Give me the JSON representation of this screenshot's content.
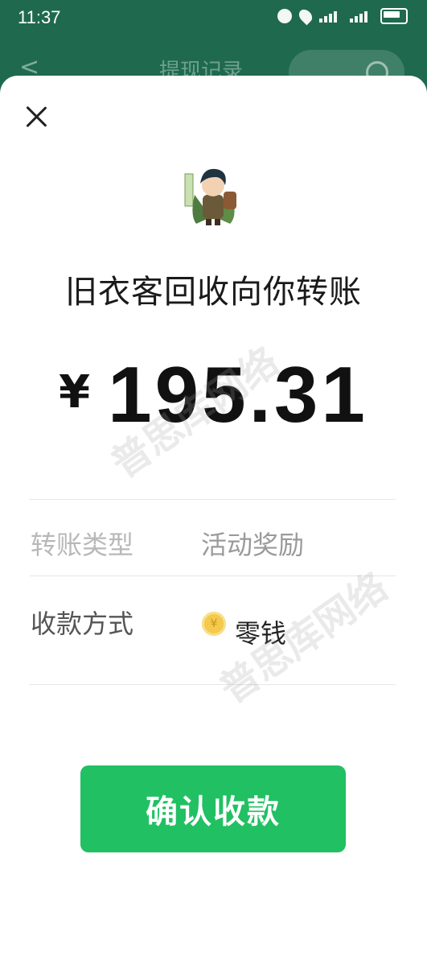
{
  "status_bar": {
    "time": "11:37"
  },
  "background_nav": {
    "title": "提现记录",
    "back": "<"
  },
  "sheet": {
    "payer_text": "旧衣客回收向你转账",
    "currency_symbol": "¥",
    "amount": "195.31",
    "rows": [
      {
        "label": "转账类型",
        "value": "活动奖励"
      },
      {
        "label": "收款方式",
        "value": "零钱"
      }
    ],
    "coin_symbol": "¥",
    "confirm_button": "确认收款",
    "watermarks": [
      "普思库网络",
      "普思库网络"
    ]
  },
  "icons": [
    "close-icon",
    "alarm-icon",
    "location-icon",
    "signal-icon",
    "battery-icon",
    "coin-icon",
    "avatar-image"
  ],
  "colors": {
    "accent_green": "#21c063",
    "header_bg": "#1f6a4f"
  }
}
